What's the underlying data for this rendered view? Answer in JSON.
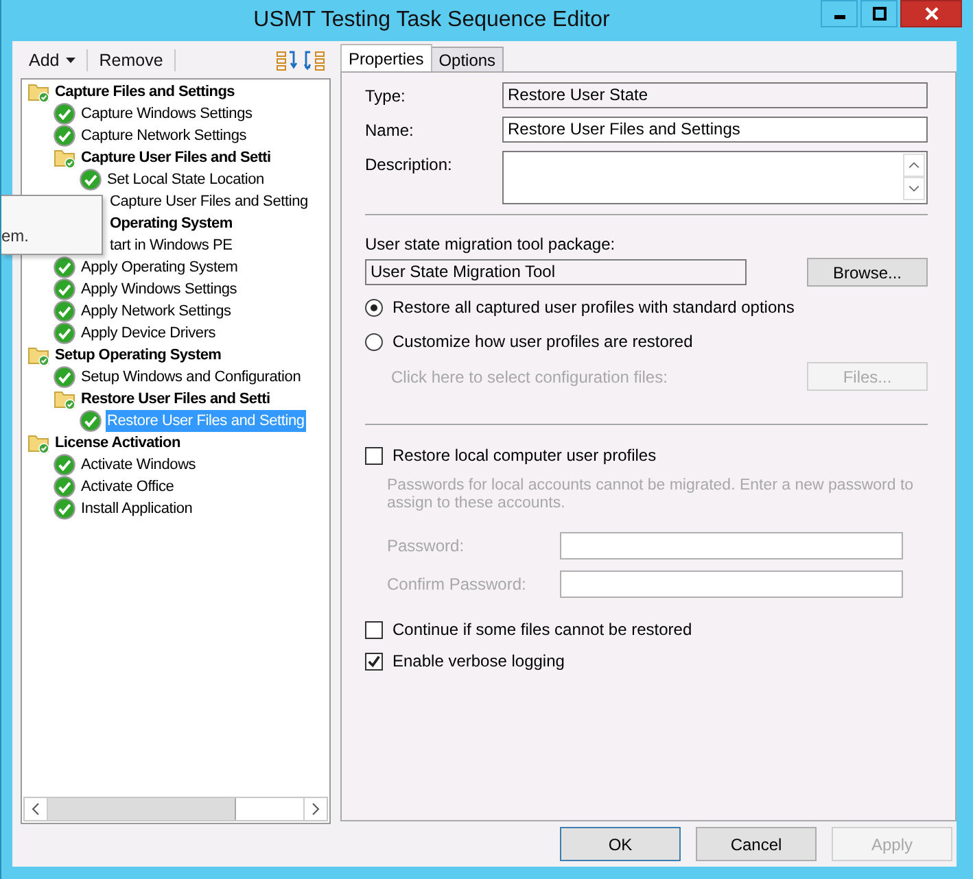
{
  "window": {
    "title": "USMT Testing Task Sequence Editor"
  },
  "toolbar": {
    "add": "Add",
    "remove": "Remove"
  },
  "tree": [
    {
      "label": "Capture Files and Settings",
      "kind": "group",
      "selected": false,
      "children": [
        {
          "label": "Capture Windows Settings",
          "kind": "step",
          "selected": false
        },
        {
          "label": "Capture Network Settings",
          "kind": "step",
          "selected": false
        },
        {
          "label": "Capture User Files and Setti",
          "kind": "group",
          "selected": false,
          "children": [
            {
              "label": "Set Local State Location",
              "kind": "step",
              "selected": false
            },
            {
              "label": "Capture User Files and Setting",
              "kind": "step",
              "selected": false,
              "covered": true
            }
          ]
        }
      ]
    },
    {
      "label": "Operating System",
      "kind": "group",
      "selected": false,
      "covered": true,
      "children": [
        {
          "label": "tart in Windows PE",
          "kind": "step",
          "selected": false,
          "covered": true
        },
        {
          "label": "Apply Operating System",
          "kind": "step",
          "selected": false
        },
        {
          "label": "Apply Windows Settings",
          "kind": "step",
          "selected": false
        },
        {
          "label": "Apply Network Settings",
          "kind": "step",
          "selected": false
        },
        {
          "label": "Apply Device Drivers",
          "kind": "step",
          "selected": false
        }
      ]
    },
    {
      "label": "Setup Operating System",
      "kind": "group",
      "selected": false,
      "children": [
        {
          "label": "Setup Windows and Configuration",
          "kind": "step",
          "selected": false
        },
        {
          "label": "Restore User Files and Setti",
          "kind": "group",
          "selected": false,
          "children": [
            {
              "label": "Restore User Files and Setting",
              "kind": "step",
              "selected": true
            }
          ]
        }
      ]
    },
    {
      "label": "License Activation",
      "kind": "group",
      "selected": false,
      "children": [
        {
          "label": "Activate Windows",
          "kind": "step",
          "selected": false
        },
        {
          "label": "Activate Office",
          "kind": "step",
          "selected": false
        },
        {
          "label": "Install Application",
          "kind": "step",
          "selected": false
        }
      ]
    }
  ],
  "tooltip": {
    "text": "em."
  },
  "tabs": [
    {
      "label": "Properties",
      "selected": true
    },
    {
      "label": "Options",
      "selected": false
    }
  ],
  "properties": {
    "type": {
      "label": "Type:",
      "value": "Restore User State"
    },
    "name": {
      "label": "Name:",
      "value": "Restore User Files and Settings"
    },
    "description": {
      "label": "Description:"
    },
    "package": {
      "label": "User state migration tool package:",
      "value": "User State Migration Tool",
      "button": "Browse..."
    },
    "radios": [
      {
        "label": "Restore all captured user profiles with standard options",
        "selected": true
      },
      {
        "label": "Customize how user profiles are restored",
        "selected": false
      }
    ],
    "config": {
      "label": "Click here to select configuration files:",
      "button": "Files...",
      "disabled": true
    },
    "restore_local": {
      "label": "Restore local computer user profiles",
      "checked": false
    },
    "password_note": {
      "text": "Passwords for local accounts cannot be migrated. Enter a new password to assign to these accounts.",
      "disabled": true
    },
    "password": {
      "label": "Password:",
      "disabled": true
    },
    "confirm_password": {
      "label": "Confirm Password:",
      "disabled": true
    },
    "options": [
      {
        "label": "Continue if some files cannot be restored",
        "checked": false
      },
      {
        "label": "Enable verbose logging",
        "checked": true
      }
    ]
  },
  "buttons": [
    {
      "label": "OK",
      "disabled": false,
      "default": true
    },
    {
      "label": "Cancel",
      "disabled": false,
      "default": false
    },
    {
      "label": "Apply",
      "disabled": true,
      "default": false
    }
  ]
}
